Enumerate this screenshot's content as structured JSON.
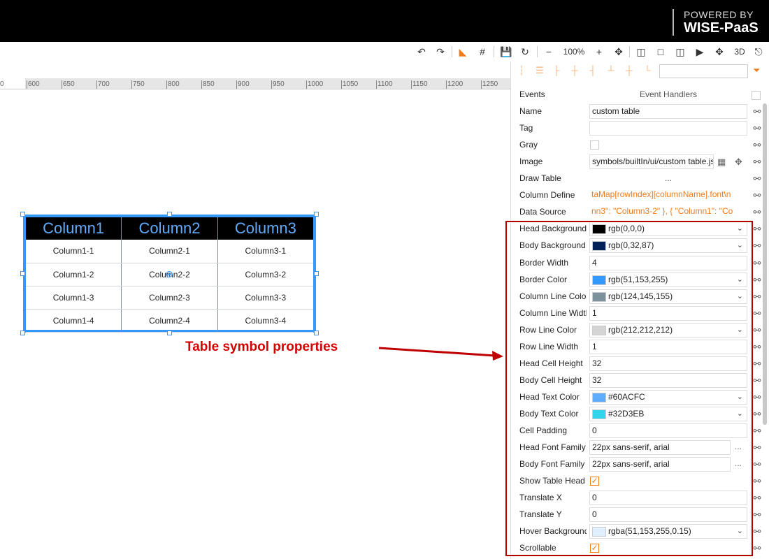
{
  "brand": {
    "line1": "POWERED BY",
    "line2": "WISE-PaaS"
  },
  "toolbar": {
    "undo_icon": "undo-icon",
    "redo_icon": "redo-icon",
    "zoom_level": "100%",
    "view_3d": "3D"
  },
  "ruler": {
    "ticks": [
      "0",
      "600",
      "650",
      "700",
      "750",
      "800",
      "850",
      "900",
      "950",
      "1000",
      "1050",
      "1100",
      "1150",
      "1200",
      "1250"
    ]
  },
  "table_symbol": {
    "head_background": "#000000",
    "head_text_color": "#60ACFC",
    "border_color": "#3399ff",
    "headers": [
      "Column1",
      "Column2",
      "Column3"
    ],
    "rows": [
      [
        "Column1-1",
        "Column2-1",
        "Column3-1"
      ],
      [
        "Column1-2",
        "Column2-2",
        "Column3-2"
      ],
      [
        "Column1-3",
        "Column2-3",
        "Column3-3"
      ],
      [
        "Column1-4",
        "Column2-4",
        "Column3-4"
      ]
    ]
  },
  "annotation": {
    "text": "Table symbol properties",
    "color": "#d40000"
  },
  "panel": {
    "events_label": "Events",
    "event_handlers_label": "Event Handlers",
    "name_label": "Name",
    "name_value": "custom table",
    "tag_label": "Tag",
    "tag_value": "",
    "gray_label": "Gray",
    "image_label": "Image",
    "image_value": "symbols/builtIn/ui/custom table.js",
    "draw_table_label": "Draw Table",
    "draw_table_value": "...",
    "column_define_label": "Column Define",
    "column_define_value": "taMap[rowIndex][columnName].font\\n",
    "data_source_label": "Data Source",
    "data_source_value": "nn3\": \"Column3-2\"   },   {     \"Column1\": \"Co",
    "head_bg_label": "Head Background",
    "head_bg_value": "rgb(0,0,0)",
    "head_bg_color": "#000000",
    "body_bg_label": "Body Background",
    "body_bg_value": "rgb(0,32,87)",
    "body_bg_color": "#002057",
    "border_width_label": "Border Width",
    "border_width_value": "4",
    "border_color_label": "Border Color",
    "border_color_value": "rgb(51,153,255)",
    "border_color_color": "#3399ff",
    "col_line_color_label": "Column Line Color",
    "col_line_color_value": "rgb(124,145,155)",
    "col_line_color_color": "#7c919b",
    "col_line_width_label": "Column Line Width",
    "col_line_width_value": "1",
    "row_line_color_label": "Row Line Color",
    "row_line_color_value": "rgb(212,212,212)",
    "row_line_color_color": "#d4d4d4",
    "row_line_width_label": "Row Line Width",
    "row_line_width_value": "1",
    "head_cell_height_label": "Head Cell Height",
    "head_cell_height_value": "32",
    "body_cell_height_label": "Body Cell Height",
    "body_cell_height_value": "32",
    "head_text_color_label": "Head Text Color",
    "head_text_color_value": "#60ACFC",
    "head_text_color_color": "#60acfc",
    "body_text_color_label": "Body Text Color",
    "body_text_color_value": "#32D3EB",
    "body_text_color_color": "#32d3eb",
    "cell_padding_label": "Cell Padding",
    "cell_padding_value": "0",
    "head_font_label": "Head Font Family",
    "head_font_value": "22px sans-serif, arial",
    "body_font_label": "Body Font Family",
    "body_font_value": "22px sans-serif, arial",
    "show_head_label": "Show Table Head",
    "translate_x_label": "Translate X",
    "translate_x_value": "0",
    "translate_y_label": "Translate Y",
    "translate_y_value": "0",
    "hover_bg_label": "Hover Background",
    "hover_bg_value": "rgba(51,153,255,0.15)",
    "hover_bg_color": "#e0effe",
    "scrollable_label": "Scrollable",
    "more_dots": "...",
    "link_glyph": "⚯"
  }
}
